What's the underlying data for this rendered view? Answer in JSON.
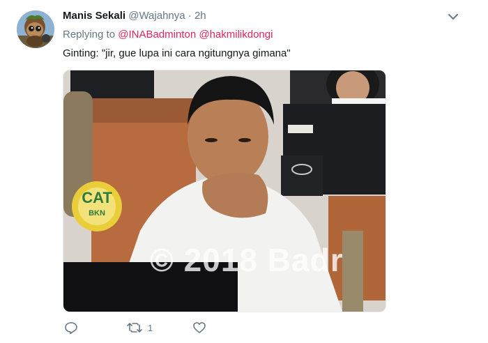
{
  "tweet": {
    "display_name": "Manis Sekali",
    "handle": "@Wajahnya",
    "separator": "·",
    "time": "2h",
    "replying_to_label": "Replying to",
    "mentions": [
      "@INABadminton",
      "@hakmilikdongi"
    ],
    "text": "Ginting: \"jir, gue lupa ini cara ngitungnya gimana\"",
    "image_watermark": "© 2018 Badr",
    "retweet_count": "1"
  },
  "icons": {
    "menu": "chevron-down-icon",
    "reply": "reply-icon",
    "retweet": "retweet-icon",
    "like": "heart-icon"
  },
  "colors": {
    "name": "#14171a",
    "meta": "#657786",
    "mention": "#e0245e",
    "action": "#657786"
  }
}
